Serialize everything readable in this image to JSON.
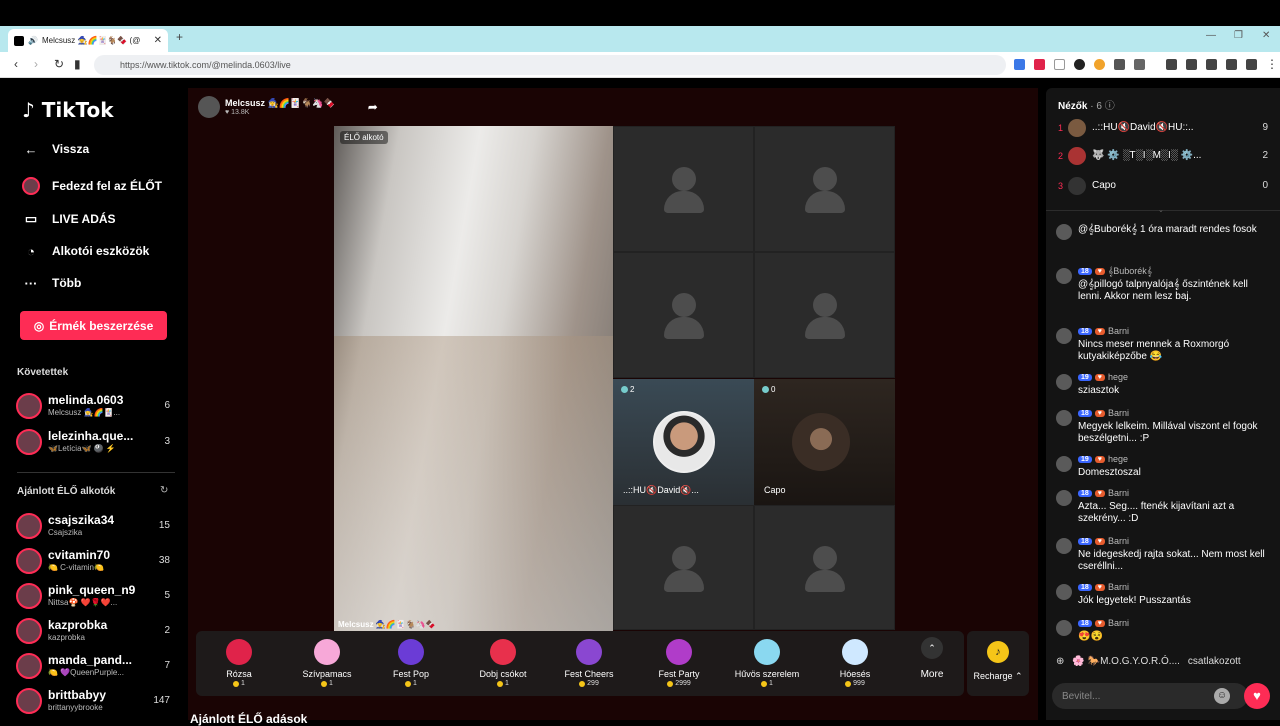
{
  "browser": {
    "tab_title": "Melcsusz 🧙‍♀️🌈🃏🐐🍫 (@",
    "new_tab": "+",
    "url": "https://www.tiktok.com/@melinda.0603/live",
    "minimize": "—",
    "restore": "❐",
    "close": "✕"
  },
  "sidebar": {
    "logo": "TikTok",
    "back": "Vissza",
    "explore_live": "Fedezd fel az ÉLŐT",
    "live_adas": "LIVE ADÁS",
    "creator_tools": "Alkotói eszközök",
    "more": "Több",
    "coins_button": "Érmék beszerzése",
    "following_title": "Követettek",
    "following": [
      {
        "name": "melinda.0603",
        "sub": "Melcsusz 🧙‍♀️🌈🃏...",
        "count": "6"
      },
      {
        "name": "lelezinha.que...",
        "sub": "🦋Letícia🦋 🎱 ⚡",
        "count": "3"
      }
    ],
    "recommended_title": "Ajánlott ÉLŐ alkotók",
    "recommended": [
      {
        "name": "csajszika34",
        "sub": "Csajszika",
        "count": "15"
      },
      {
        "name": "cvitamin70",
        "sub": "🍋 C-vitamin🍋",
        "count": "38"
      },
      {
        "name": "pink_queen_n9",
        "sub": "Nittsa🍄 ❤️🌹❤️...",
        "count": "5"
      },
      {
        "name": "kazprobka",
        "sub": "kazprobka",
        "count": "2"
      },
      {
        "name": "manda_pand...",
        "sub": "🍋 💜QueenPurple...",
        "count": "7"
      },
      {
        "name": "brittbabyy",
        "sub": "brittanyybrooke",
        "count": "147"
      }
    ]
  },
  "stage": {
    "host_name": "Melcsusz 🧙‍♀️🌈🃏🐐🦄🍫",
    "host_likes": "♥ 13.8K",
    "live_label": "ÉLŐ alkotó",
    "video_name": "Melcsusz 🧙‍♀️🌈🃏🐐🦄🍫",
    "guests": [
      {
        "count": "2",
        "name": "..::HU🔇David🔇..."
      },
      {
        "count": "0",
        "name": "Capo"
      }
    ],
    "gifts": [
      {
        "name": "Rózsa",
        "price": "1",
        "color": "#e0234a"
      },
      {
        "name": "Szívpamacs",
        "price": "1",
        "color": "#f7a8d8"
      },
      {
        "name": "Fest Pop",
        "price": "1",
        "color": "#6b3cd6"
      },
      {
        "name": "Dobj csókot",
        "price": "1",
        "color": "#e8304c"
      },
      {
        "name": "Fest Cheers",
        "price": "299",
        "color": "#8a47d1"
      },
      {
        "name": "Fest Party",
        "price": "2999",
        "color": "#b03cc9"
      },
      {
        "name": "Hűvös szerelem",
        "price": "1",
        "color": "#8ad8f0"
      },
      {
        "name": "Hóesés",
        "price": "999",
        "color": "#cfe8ff"
      }
    ],
    "more_label": "More",
    "recharge_label": "Recharge ⌃",
    "bottom_title": "Ajánlott ÉLŐ adások"
  },
  "rpanel": {
    "viewers_title": "Nézők",
    "viewers_count": "· 6",
    "viewers": [
      {
        "rank": "1",
        "name": "..::HU🔇David🔇HU::..",
        "score": "9"
      },
      {
        "rank": "2",
        "name": "🐺 ⚙️ ░T░I░M░I░ ⚙️...",
        "score": "2"
      },
      {
        "rank": "3",
        "name": "Capo",
        "score": "0"
      }
    ],
    "messages": [
      {
        "level": "",
        "name": "",
        "text": "@𝄞Buborék𝄞 1 óra maradt rendes fosok"
      },
      {
        "level": "18",
        "name": "𝄞Buborék𝄞",
        "text": "@𝄞pillogó talpnyalója𝄞 őszintének kell lenni. Akkor nem lesz baj."
      },
      {
        "level": "18",
        "name": "Barni",
        "text": "Nincs meser mennek a Roxmorgó kutyakiképzőbe 😂"
      },
      {
        "level": "19",
        "name": "hege",
        "text": "sziasztok"
      },
      {
        "level": "18",
        "name": "Barni",
        "text": "Megyek lelkeim. Millával viszont el fogok beszélgetni... :P"
      },
      {
        "level": "19",
        "name": "hege",
        "text": "Domesztoszal"
      },
      {
        "level": "18",
        "name": "Barni",
        "text": "Azta... Seg.... ftenék kijavítani azt a szekrény... :D"
      },
      {
        "level": "18",
        "name": "Barni",
        "text": "Ne idegeskedj rajta sokat... Nem most kell cseréllni..."
      },
      {
        "level": "18",
        "name": "Barni",
        "text": "Jók legyetek! Pusszantás"
      },
      {
        "level": "18",
        "name": "Barni",
        "text": "😍😵"
      }
    ],
    "join_name": "🌸 🐎M.O.G.Y.O.R.Ó....",
    "join_text": "csatlakozott",
    "input_placeholder": "Bevitel..."
  }
}
